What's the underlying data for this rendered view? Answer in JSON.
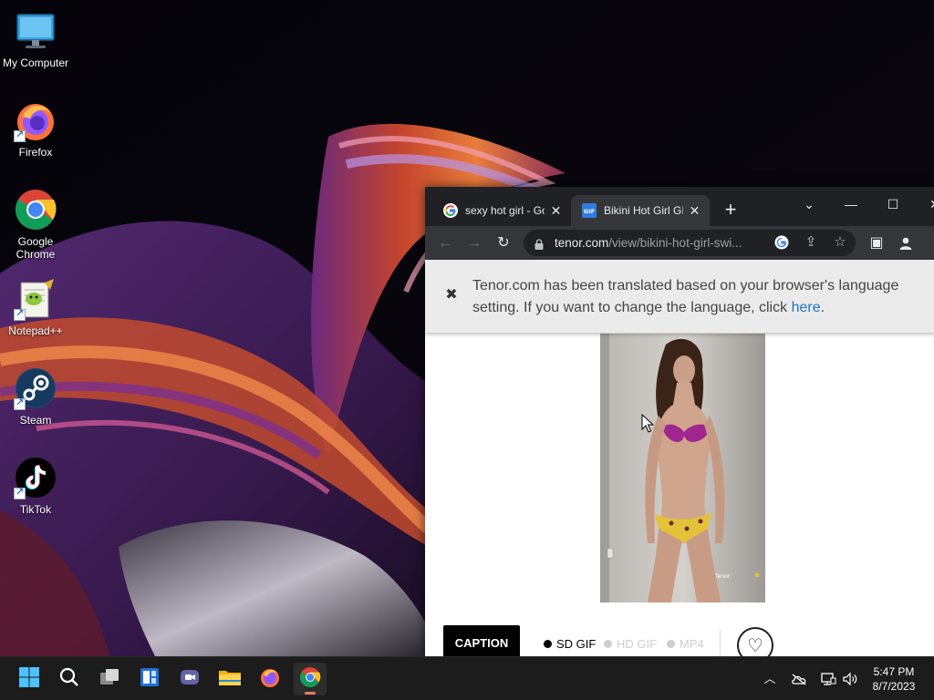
{
  "desktop": {
    "icons": [
      {
        "label": "My Computer",
        "icon": "monitor-icon"
      },
      {
        "label": "Firefox",
        "icon": "firefox-icon"
      },
      {
        "label": "Google Chrome",
        "icon": "chrome-icon"
      },
      {
        "label": "Notepad++",
        "icon": "notepad-plus-plus-icon"
      },
      {
        "label": "Steam",
        "icon": "steam-icon"
      },
      {
        "label": "TikTok",
        "icon": "tiktok-icon"
      }
    ]
  },
  "browser": {
    "tabs": [
      {
        "title": "sexy hot girl - Go",
        "favicon": "google-icon",
        "active": false
      },
      {
        "title": "Bikini Hot Girl GIF",
        "favicon": "gif-icon",
        "active": true
      }
    ],
    "new_tab_label": "+",
    "address": {
      "host": "tenor.com",
      "path": "/view/bikini-hot-girl-swi..."
    },
    "translate_bar": {
      "message": "Tenor.com has been translated based on your browser's language setting. If you want to change the language, click",
      "link": "here",
      "suffix": "."
    },
    "page": {
      "caption_button": "CAPTION",
      "formats": [
        {
          "label": "SD GIF",
          "selected": true
        },
        {
          "label": "HD GIF",
          "selected": false
        },
        {
          "label": "MP4",
          "selected": false
        }
      ],
      "watermark": "Tenor"
    }
  },
  "taskbar": {
    "apps": [
      "start-icon",
      "search-icon",
      "task-view-icon",
      "widgets-icon",
      "chat-icon",
      "file-explorer-icon",
      "firefox-icon",
      "chrome-icon"
    ],
    "active_app": "chrome-icon",
    "clock": {
      "time": "5:47 PM",
      "date": "8/7/2023"
    }
  },
  "colors": {
    "accent_link": "#1a73c8",
    "taskbar": "#1c1c1c",
    "chrome_dark": "#202124",
    "active_indicator": "#f07a5a"
  }
}
